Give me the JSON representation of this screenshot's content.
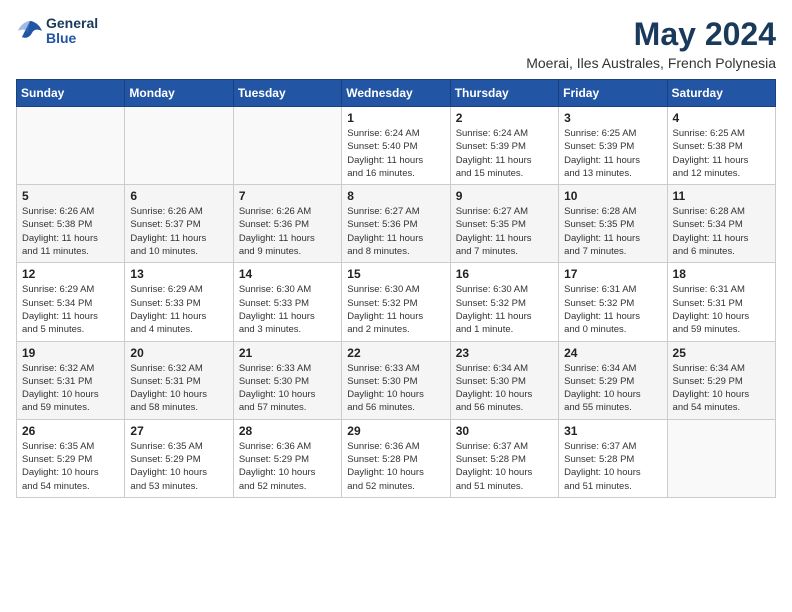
{
  "logo": {
    "line1": "General",
    "line2": "Blue"
  },
  "title": {
    "month_year": "May 2024",
    "location": "Moerai, Iles Australes, French Polynesia"
  },
  "weekdays": [
    "Sunday",
    "Monday",
    "Tuesday",
    "Wednesday",
    "Thursday",
    "Friday",
    "Saturday"
  ],
  "weeks": [
    [
      {
        "day": "",
        "info": ""
      },
      {
        "day": "",
        "info": ""
      },
      {
        "day": "",
        "info": ""
      },
      {
        "day": "1",
        "info": "Sunrise: 6:24 AM\nSunset: 5:40 PM\nDaylight: 11 hours\nand 16 minutes."
      },
      {
        "day": "2",
        "info": "Sunrise: 6:24 AM\nSunset: 5:39 PM\nDaylight: 11 hours\nand 15 minutes."
      },
      {
        "day": "3",
        "info": "Sunrise: 6:25 AM\nSunset: 5:39 PM\nDaylight: 11 hours\nand 13 minutes."
      },
      {
        "day": "4",
        "info": "Sunrise: 6:25 AM\nSunset: 5:38 PM\nDaylight: 11 hours\nand 12 minutes."
      }
    ],
    [
      {
        "day": "5",
        "info": "Sunrise: 6:26 AM\nSunset: 5:38 PM\nDaylight: 11 hours\nand 11 minutes."
      },
      {
        "day": "6",
        "info": "Sunrise: 6:26 AM\nSunset: 5:37 PM\nDaylight: 11 hours\nand 10 minutes."
      },
      {
        "day": "7",
        "info": "Sunrise: 6:26 AM\nSunset: 5:36 PM\nDaylight: 11 hours\nand 9 minutes."
      },
      {
        "day": "8",
        "info": "Sunrise: 6:27 AM\nSunset: 5:36 PM\nDaylight: 11 hours\nand 8 minutes."
      },
      {
        "day": "9",
        "info": "Sunrise: 6:27 AM\nSunset: 5:35 PM\nDaylight: 11 hours\nand 7 minutes."
      },
      {
        "day": "10",
        "info": "Sunrise: 6:28 AM\nSunset: 5:35 PM\nDaylight: 11 hours\nand 7 minutes."
      },
      {
        "day": "11",
        "info": "Sunrise: 6:28 AM\nSunset: 5:34 PM\nDaylight: 11 hours\nand 6 minutes."
      }
    ],
    [
      {
        "day": "12",
        "info": "Sunrise: 6:29 AM\nSunset: 5:34 PM\nDaylight: 11 hours\nand 5 minutes."
      },
      {
        "day": "13",
        "info": "Sunrise: 6:29 AM\nSunset: 5:33 PM\nDaylight: 11 hours\nand 4 minutes."
      },
      {
        "day": "14",
        "info": "Sunrise: 6:30 AM\nSunset: 5:33 PM\nDaylight: 11 hours\nand 3 minutes."
      },
      {
        "day": "15",
        "info": "Sunrise: 6:30 AM\nSunset: 5:32 PM\nDaylight: 11 hours\nand 2 minutes."
      },
      {
        "day": "16",
        "info": "Sunrise: 6:30 AM\nSunset: 5:32 PM\nDaylight: 11 hours\nand 1 minute."
      },
      {
        "day": "17",
        "info": "Sunrise: 6:31 AM\nSunset: 5:32 PM\nDaylight: 11 hours\nand 0 minutes."
      },
      {
        "day": "18",
        "info": "Sunrise: 6:31 AM\nSunset: 5:31 PM\nDaylight: 10 hours\nand 59 minutes."
      }
    ],
    [
      {
        "day": "19",
        "info": "Sunrise: 6:32 AM\nSunset: 5:31 PM\nDaylight: 10 hours\nand 59 minutes."
      },
      {
        "day": "20",
        "info": "Sunrise: 6:32 AM\nSunset: 5:31 PM\nDaylight: 10 hours\nand 58 minutes."
      },
      {
        "day": "21",
        "info": "Sunrise: 6:33 AM\nSunset: 5:30 PM\nDaylight: 10 hours\nand 57 minutes."
      },
      {
        "day": "22",
        "info": "Sunrise: 6:33 AM\nSunset: 5:30 PM\nDaylight: 10 hours\nand 56 minutes."
      },
      {
        "day": "23",
        "info": "Sunrise: 6:34 AM\nSunset: 5:30 PM\nDaylight: 10 hours\nand 56 minutes."
      },
      {
        "day": "24",
        "info": "Sunrise: 6:34 AM\nSunset: 5:29 PM\nDaylight: 10 hours\nand 55 minutes."
      },
      {
        "day": "25",
        "info": "Sunrise: 6:34 AM\nSunset: 5:29 PM\nDaylight: 10 hours\nand 54 minutes."
      }
    ],
    [
      {
        "day": "26",
        "info": "Sunrise: 6:35 AM\nSunset: 5:29 PM\nDaylight: 10 hours\nand 54 minutes."
      },
      {
        "day": "27",
        "info": "Sunrise: 6:35 AM\nSunset: 5:29 PM\nDaylight: 10 hours\nand 53 minutes."
      },
      {
        "day": "28",
        "info": "Sunrise: 6:36 AM\nSunset: 5:29 PM\nDaylight: 10 hours\nand 52 minutes."
      },
      {
        "day": "29",
        "info": "Sunrise: 6:36 AM\nSunset: 5:28 PM\nDaylight: 10 hours\nand 52 minutes."
      },
      {
        "day": "30",
        "info": "Sunrise: 6:37 AM\nSunset: 5:28 PM\nDaylight: 10 hours\nand 51 minutes."
      },
      {
        "day": "31",
        "info": "Sunrise: 6:37 AM\nSunset: 5:28 PM\nDaylight: 10 hours\nand 51 minutes."
      },
      {
        "day": "",
        "info": ""
      }
    ]
  ]
}
